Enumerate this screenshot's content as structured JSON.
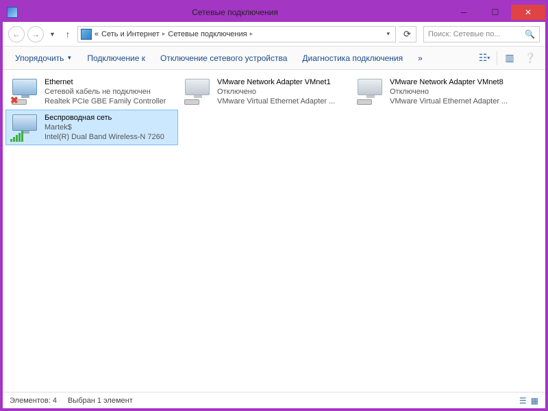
{
  "window": {
    "title": "Сетевые подключения"
  },
  "breadcrumb": {
    "prefix": "«",
    "part1": "Сеть и Интернет",
    "part2": "Сетевые подключения"
  },
  "search": {
    "placeholder": "Поиск: Сетевые по..."
  },
  "toolbar": {
    "organize": "Упорядочить",
    "connect": "Подключение к",
    "disable": "Отключение сетевого устройства",
    "diagnose": "Диагностика подключения",
    "more": "»"
  },
  "items": [
    {
      "name": "Ethernet",
      "status": "Сетевой кабель не подключен",
      "device": "Realtek PCIe GBE Family Controller",
      "selected": false,
      "iconState": "unplugged"
    },
    {
      "name": "VMware Network Adapter VMnet1",
      "status": "Отключено",
      "device": "VMware Virtual Ethernet Adapter ...",
      "selected": false,
      "iconState": "disabled"
    },
    {
      "name": "VMware Network Adapter VMnet8",
      "status": "Отключено",
      "device": "VMware Virtual Ethernet Adapter ...",
      "selected": false,
      "iconState": "disabled"
    },
    {
      "name": "Беспроводная сеть",
      "status": "Martek$",
      "device": "Intel(R) Dual Band Wireless-N 7260",
      "selected": true,
      "iconState": "wifi"
    }
  ],
  "statusbar": {
    "count": "Элементов: 4",
    "selected": "Выбран 1 элемент"
  }
}
